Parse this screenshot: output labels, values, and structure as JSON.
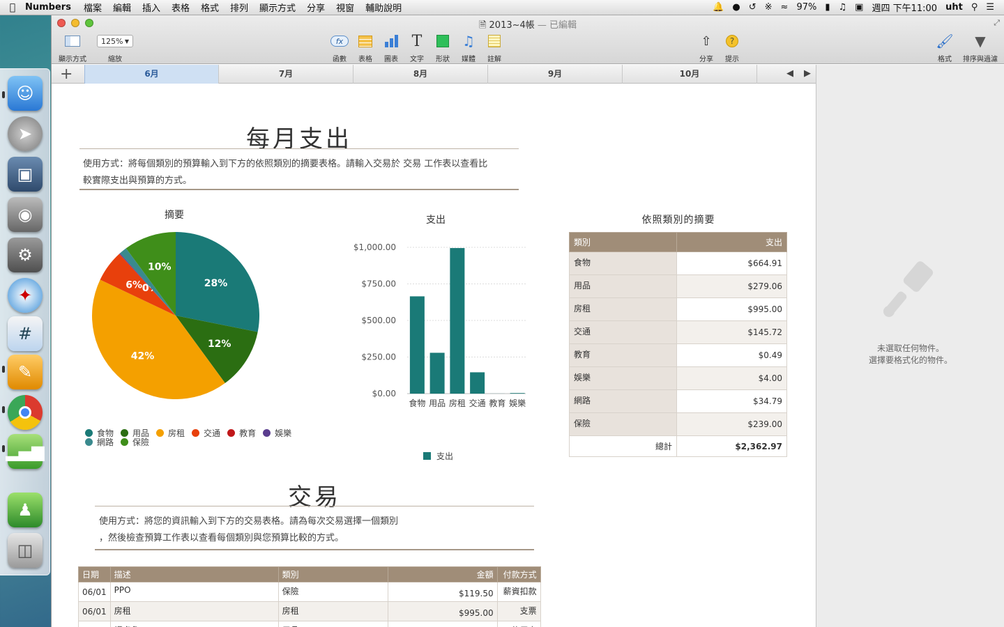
{
  "menubar": {
    "apple_icon": "apple-logo-icon",
    "app_name": "Numbers",
    "menus": [
      "檔案",
      "編輯",
      "插入",
      "表格",
      "格式",
      "排列",
      "顯示方式",
      "分享",
      "視窗",
      "輔助說明"
    ],
    "battery": "97%",
    "clock": "週四 下午11:00",
    "user": "uht"
  },
  "window": {
    "title": "2013~4帳",
    "edited": "— 已編輯"
  },
  "toolbar": {
    "view_label": "顯示方式",
    "zoom_value": "125%",
    "zoom_label": "縮放",
    "function_label": "函數",
    "table_label": "表格",
    "chart_label": "圖表",
    "text_label": "文字",
    "shape_label": "形狀",
    "media_label": "媒體",
    "comment_label": "註解",
    "share_label": "分享",
    "tips_label": "提示",
    "format_label": "格式",
    "sort_label": "排序與過濾"
  },
  "sheets": {
    "tabs": [
      "6月",
      "7月",
      "8月",
      "9月",
      "10月"
    ],
    "active": 0
  },
  "sidepanel": {
    "line1": "未選取任何物件。",
    "line2": "選擇要格式化的物件。"
  },
  "budget": {
    "title": "每月支出",
    "instructions_line1": "使用方式：將每個類別的預算輸入到下方的依照類別的摘要表格。請輸入交易於 交易 工作表以查看比",
    "instructions_line2": "較實際支出與預算的方式。"
  },
  "chart_data": [
    {
      "type": "pie",
      "title": "摘要",
      "categories": [
        "食物",
        "用品",
        "房租",
        "交通",
        "教育",
        "娛樂",
        "網路",
        "保險"
      ],
      "values": [
        664.91,
        279.06,
        995.0,
        145.72,
        0.49,
        4.0,
        34.79,
        239.0
      ],
      "labels": [
        "28%",
        "12%",
        "42%",
        "6%",
        "0%",
        "0%",
        "",
        "10%"
      ],
      "colors": [
        "#1a7a77",
        "#2b6e12",
        "#f4a000",
        "#e8400c",
        "#c0181a",
        "#5a3d8e",
        "#3a8a8e",
        "#3f8e1a"
      ],
      "legend_position": "bottom"
    },
    {
      "type": "bar",
      "title": "支出",
      "categories": [
        "食物",
        "用品",
        "房租",
        "交通",
        "教育",
        "娛樂",
        "網路",
        "保險"
      ],
      "series": [
        {
          "name": "支出",
          "values": [
            664.91,
            279.06,
            995.0,
            145.72,
            0.49,
            4.0,
            34.79,
            239.0
          ]
        }
      ],
      "ylim": [
        0,
        1000
      ],
      "yticks": [
        "$0.00",
        "$250.00",
        "$500.00",
        "$750.00",
        "$1,000.00"
      ],
      "ytick_values": [
        0,
        250,
        500,
        750,
        1000
      ],
      "color": "#1a7a77",
      "grid": true,
      "legend_position": "bottom"
    }
  ],
  "summary": {
    "title": "依照類別的摘要",
    "col_category": "類別",
    "col_spend": "支出",
    "rows": [
      {
        "category": "食物",
        "spend": "$664.91"
      },
      {
        "category": "用品",
        "spend": "$279.06"
      },
      {
        "category": "房租",
        "spend": "$995.00"
      },
      {
        "category": "交通",
        "spend": "$145.72"
      },
      {
        "category": "教育",
        "spend": "$0.49"
      },
      {
        "category": "娛樂",
        "spend": "$4.00"
      },
      {
        "category": "網路",
        "spend": "$34.79"
      },
      {
        "category": "保險",
        "spend": "$239.00"
      }
    ],
    "total_label": "總計",
    "total_value": "$2,362.97"
  },
  "transactions": {
    "title": "交易",
    "instructions_line1": "使用方式：將您的資訊輸入到下方的交易表格。請為每次交易選擇一個類別",
    "instructions_line2": "，然後檢查預算工作表以查看每個類別與您預算比較的方式。",
    "headers": [
      "日期",
      "描述",
      "類別",
      "金額",
      "付款方式"
    ],
    "rows": [
      {
        "date": "06/01",
        "desc": "PPO",
        "category": "保險",
        "amount": "$119.50",
        "method": "薪資扣款"
      },
      {
        "date": "06/01",
        "desc": "房租",
        "category": "房租",
        "amount": "$995.00",
        "method": "支票"
      },
      {
        "date": "06/01",
        "desc": "護桌角",
        "category": "用品",
        "amount": "$2.45",
        "method": "信用卡"
      }
    ]
  }
}
